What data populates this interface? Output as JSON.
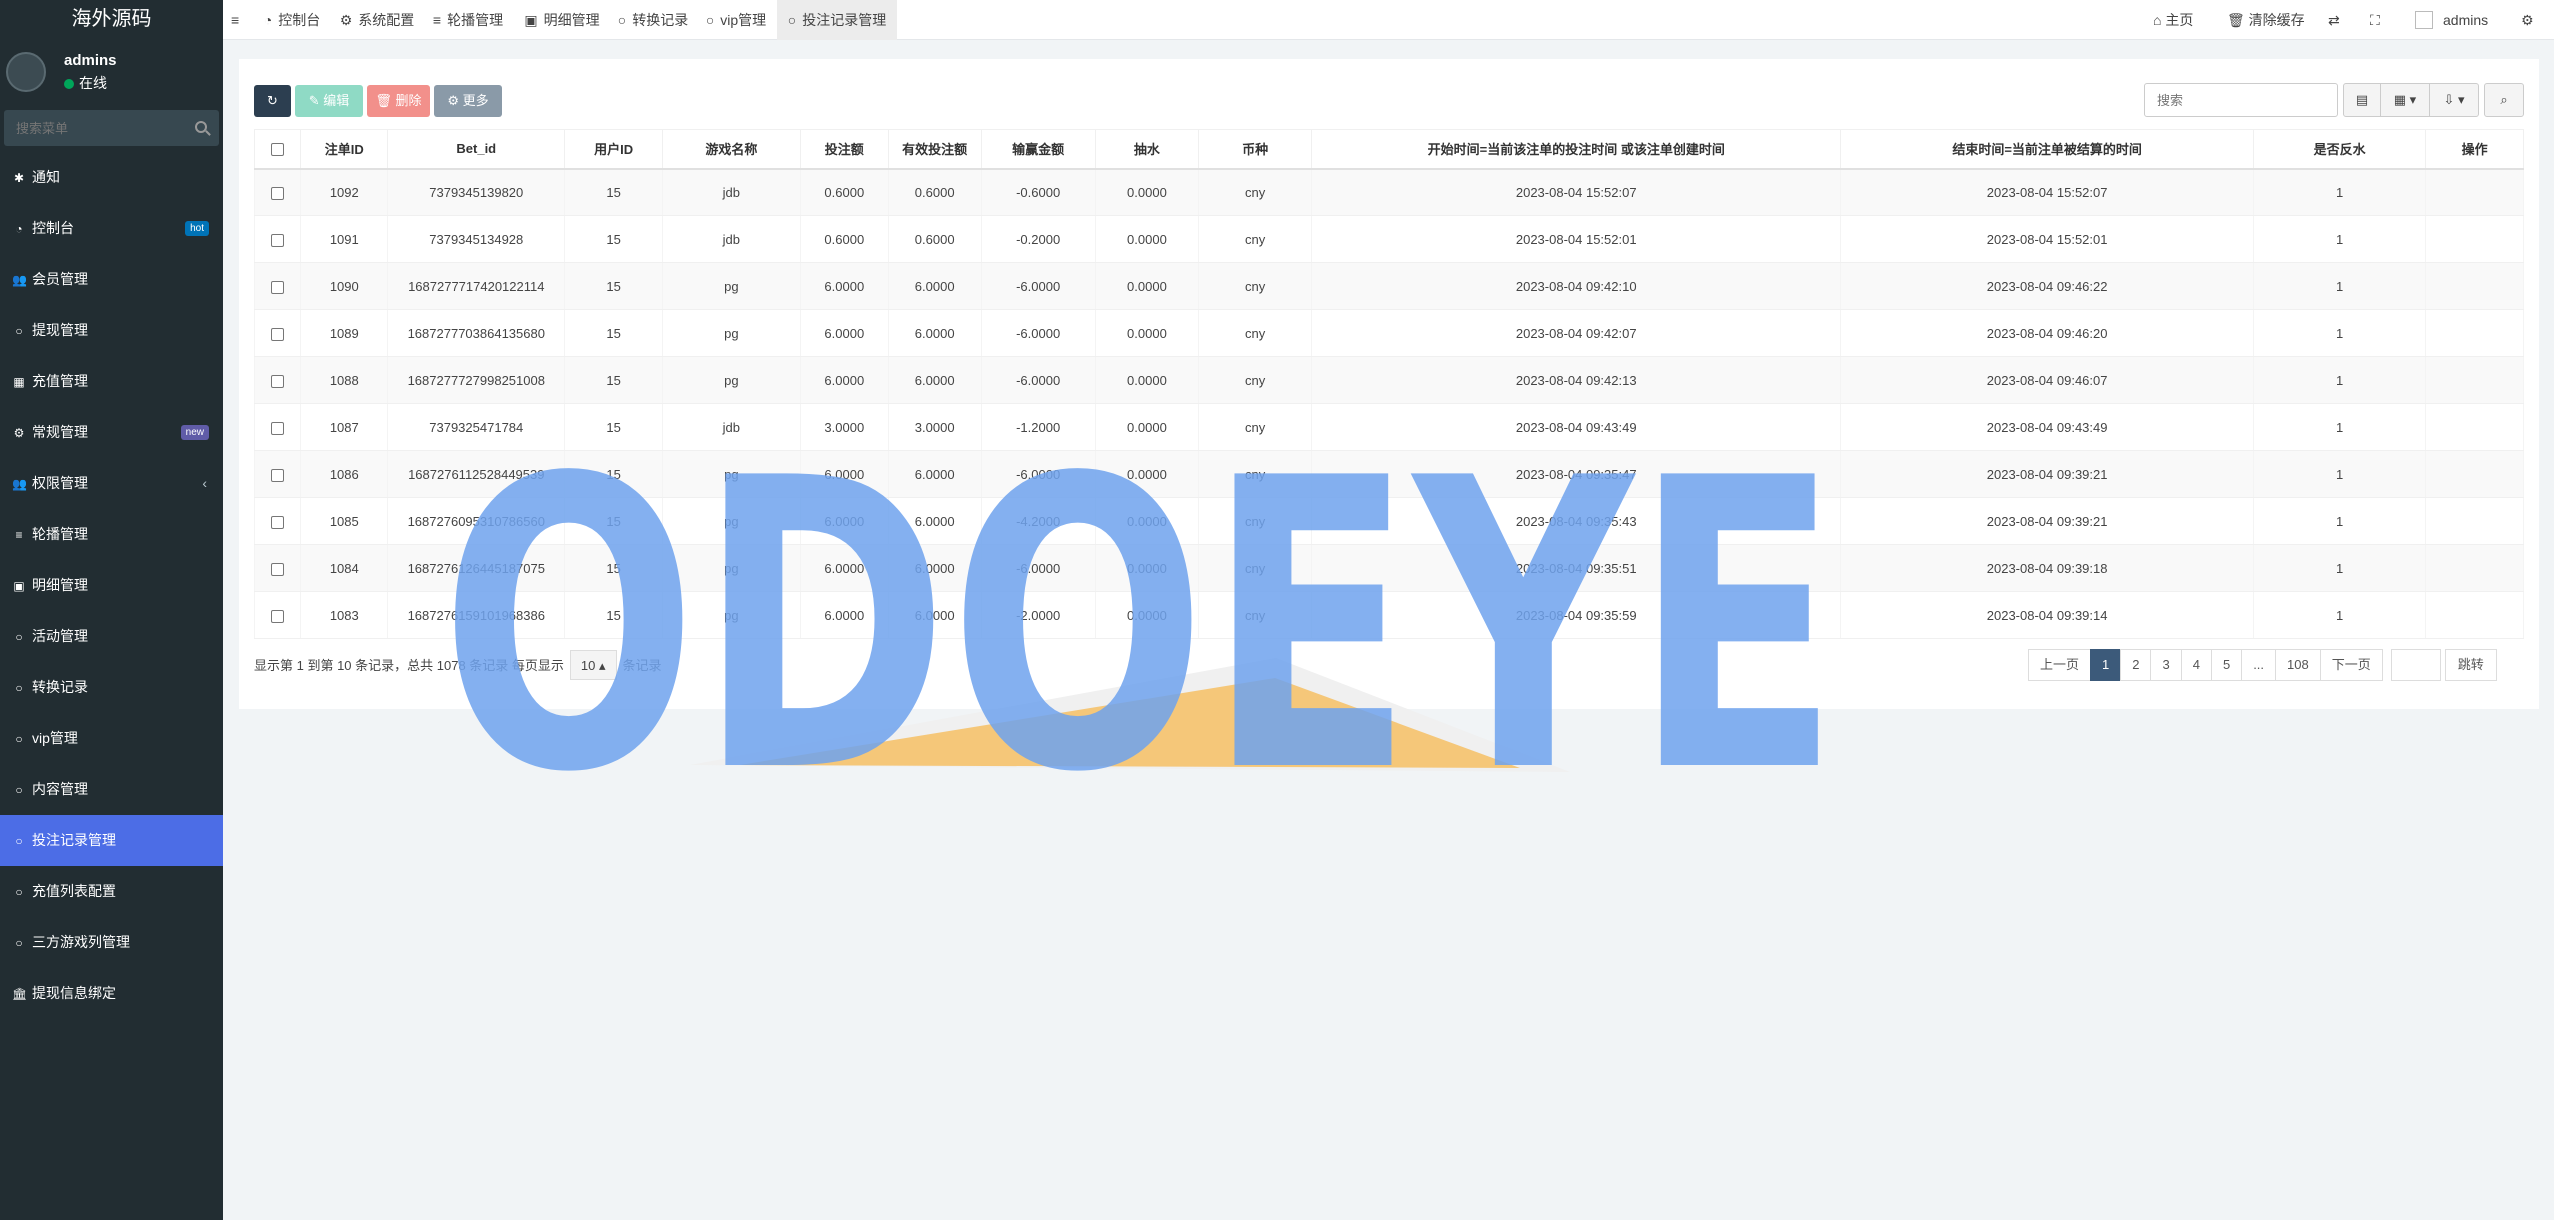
{
  "sidebar": {
    "brand": "海外源码",
    "user": {
      "name": "admins",
      "status": "在线"
    },
    "search_placeholder": "搜索菜单",
    "items": [
      {
        "label": "通知",
        "icon": "bell-icon",
        "glyph": "✱"
      },
      {
        "label": "控制台",
        "icon": "dashboard-icon",
        "glyph": "◔",
        "badge": "hot"
      },
      {
        "label": "会员管理",
        "icon": "users-icon",
        "glyph": "👥"
      },
      {
        "label": "提现管理",
        "icon": "circle-icon",
        "glyph": "○"
      },
      {
        "label": "充值管理",
        "icon": "grid-icon",
        "glyph": "▦"
      },
      {
        "label": "常规管理",
        "icon": "cogs-icon",
        "glyph": "⚙",
        "badge": "new"
      },
      {
        "label": "权限管理",
        "icon": "group-icon",
        "glyph": "👥"
      },
      {
        "label": "轮播管理",
        "icon": "list-icon",
        "glyph": "≡"
      },
      {
        "label": "明细管理",
        "icon": "calendar-icon",
        "glyph": "▣"
      },
      {
        "label": "活动管理",
        "icon": "circle-icon",
        "glyph": "○"
      },
      {
        "label": "转换记录",
        "icon": "circle-icon",
        "glyph": "○"
      },
      {
        "label": "vip管理",
        "icon": "circle-icon",
        "glyph": "○"
      },
      {
        "label": "内容管理",
        "icon": "circle-icon",
        "glyph": "○"
      },
      {
        "label": "投注记录管理",
        "icon": "circle-icon",
        "glyph": "○",
        "active": true
      },
      {
        "label": "充值列表配置",
        "icon": "circle-icon",
        "glyph": "○"
      },
      {
        "label": "三方游戏列管理",
        "icon": "circle-icon",
        "glyph": "○"
      },
      {
        "label": "提现信息绑定",
        "icon": "bank-icon",
        "glyph": "🏛"
      }
    ]
  },
  "topbar": {
    "tabs": [
      {
        "label": "控制台",
        "glyph": "◔"
      },
      {
        "label": "系统配置",
        "glyph": "⚙"
      },
      {
        "label": "轮播管理",
        "glyph": "≡"
      },
      {
        "label": "明细管理",
        "glyph": "▣"
      },
      {
        "label": "转换记录",
        "glyph": "○"
      },
      {
        "label": "vip管理",
        "glyph": "○"
      },
      {
        "label": "投注记录管理",
        "glyph": "○",
        "active": true
      }
    ],
    "right": {
      "home": "主页",
      "clear_cache": "清除缓存",
      "user": "admins"
    }
  },
  "toolbar": {
    "edit": "编辑",
    "delete": "删除",
    "more": "更多",
    "search_placeholder": "搜索"
  },
  "table": {
    "columns": [
      "注单ID",
      "Bet_id",
      "用户ID",
      "游戏名称",
      "投注额",
      "有效投注额",
      "输赢金额",
      "抽水",
      "币种",
      "开始时间=当前该注单的投注时间 或该注单创建时间",
      "结束时间=当前注单被结算的时间",
      "是否反水",
      "操作"
    ],
    "rows": [
      [
        "1092",
        "7379345139820",
        "15",
        "jdb",
        "0.6000",
        "0.6000",
        "-0.6000",
        "0.0000",
        "cny",
        "2023-08-04 15:52:07",
        "2023-08-04 15:52:07",
        "1",
        ""
      ],
      [
        "1091",
        "7379345134928",
        "15",
        "jdb",
        "0.6000",
        "0.6000",
        "-0.2000",
        "0.0000",
        "cny",
        "2023-08-04 15:52:01",
        "2023-08-04 15:52:01",
        "1",
        ""
      ],
      [
        "1090",
        "1687277717420122114",
        "15",
        "pg",
        "6.0000",
        "6.0000",
        "-6.0000",
        "0.0000",
        "cny",
        "2023-08-04 09:42:10",
        "2023-08-04 09:46:22",
        "1",
        ""
      ],
      [
        "1089",
        "1687277703864135680",
        "15",
        "pg",
        "6.0000",
        "6.0000",
        "-6.0000",
        "0.0000",
        "cny",
        "2023-08-04 09:42:07",
        "2023-08-04 09:46:20",
        "1",
        ""
      ],
      [
        "1088",
        "1687277727998251008",
        "15",
        "pg",
        "6.0000",
        "6.0000",
        "-6.0000",
        "0.0000",
        "cny",
        "2023-08-04 09:42:13",
        "2023-08-04 09:46:07",
        "1",
        ""
      ],
      [
        "1087",
        "7379325471784",
        "15",
        "jdb",
        "3.0000",
        "3.0000",
        "-1.2000",
        "0.0000",
        "cny",
        "2023-08-04 09:43:49",
        "2023-08-04 09:43:49",
        "1",
        ""
      ],
      [
        "1086",
        "1687276112528449539",
        "15",
        "pg",
        "6.0000",
        "6.0000",
        "-6.0000",
        "0.0000",
        "cny",
        "2023-08-04 09:35:47",
        "2023-08-04 09:39:21",
        "1",
        ""
      ],
      [
        "1085",
        "1687276095310786560",
        "15",
        "pg",
        "6.0000",
        "6.0000",
        "-4.2000",
        "0.0000",
        "cny",
        "2023-08-04 09:35:43",
        "2023-08-04 09:39:21",
        "1",
        ""
      ],
      [
        "1084",
        "1687276126445187075",
        "15",
        "pg",
        "6.0000",
        "6.0000",
        "-6.0000",
        "0.0000",
        "cny",
        "2023-08-04 09:35:51",
        "2023-08-04 09:39:18",
        "1",
        ""
      ],
      [
        "1083",
        "1687276159101968386",
        "15",
        "pg",
        "6.0000",
        "6.0000",
        "-2.0000",
        "0.0000",
        "cny",
        "2023-08-04 09:35:59",
        "2023-08-04 09:39:14",
        "1",
        ""
      ]
    ]
  },
  "footer": {
    "info_prefix": "显示第 1 到第 10 条记录，总共 1078 条记录 每页显示",
    "page_size": "10",
    "info_suffix": "条记录",
    "pager": [
      "上一页",
      "1",
      "2",
      "3",
      "4",
      "5",
      "...",
      "108",
      "下一页"
    ],
    "active_page": "1",
    "jump_label": "跳转"
  },
  "watermark": {
    "text": "ODOEYE",
    "letter_color": "#6fa3ee",
    "roof_color": "#f5c26b"
  }
}
